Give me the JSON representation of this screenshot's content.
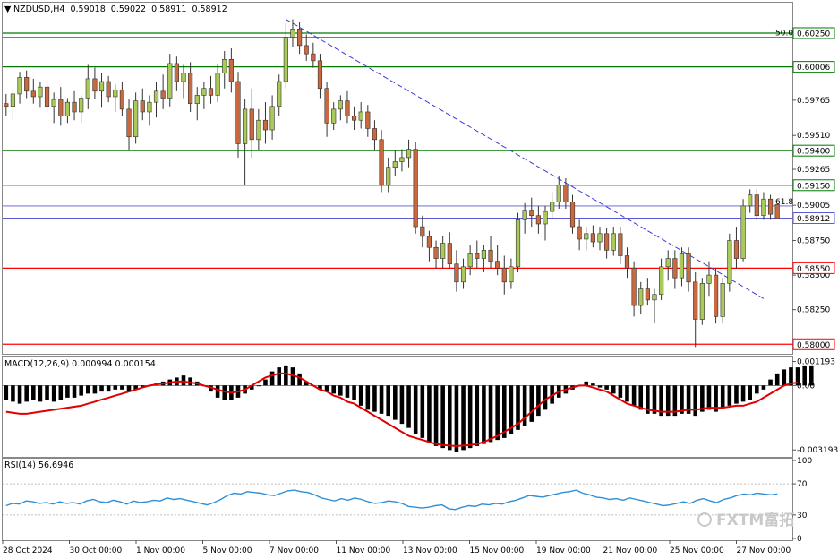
{
  "chart_data": [
    {
      "type": "candlestick",
      "header": {
        "symbol": "NZDUSD,H4",
        "open": "0.59018",
        "high": "0.59022",
        "low": "0.58911",
        "close": "0.58912"
      },
      "ylim": [
        0.5795,
        0.6036
      ],
      "y_ticks": [
        "0.60250",
        "0.60006",
        "0.59765",
        "0.59510",
        "0.59265",
        "0.59005",
        "0.58750",
        "0.58500",
        "0.58250",
        "0.58000"
      ],
      "x_labels": [
        "28 Oct 2024",
        "30 Oct 00:00",
        "1 Nov 00:00",
        "5 Nov 00:00",
        "7 Nov 00:00",
        "11 Nov 00:00",
        "13 Nov 00:00",
        "15 Nov 00:00",
        "19 Nov 00:00",
        "21 Nov 00:00",
        "25 Nov 00:00",
        "27 Nov 00:00"
      ],
      "candles": [
        [
          0.5974,
          0.5981,
          0.5965,
          0.5972
        ],
        [
          0.5972,
          0.5985,
          0.5962,
          0.5981
        ],
        [
          0.5981,
          0.5997,
          0.5974,
          0.5993
        ],
        [
          0.5993,
          0.5998,
          0.5978,
          0.5983
        ],
        [
          0.5983,
          0.5992,
          0.5974,
          0.5979
        ],
        [
          0.5979,
          0.599,
          0.5971,
          0.5986
        ],
        [
          0.5986,
          0.5991,
          0.5968,
          0.5972
        ],
        [
          0.5972,
          0.5982,
          0.596,
          0.5977
        ],
        [
          0.5977,
          0.5986,
          0.5958,
          0.5965
        ],
        [
          0.5965,
          0.5978,
          0.596,
          0.5975
        ],
        [
          0.5975,
          0.5983,
          0.5962,
          0.5968
        ],
        [
          0.5968,
          0.598,
          0.596,
          0.5978
        ],
        [
          0.5978,
          0.6002,
          0.597,
          0.5992
        ],
        [
          0.5992,
          0.6,
          0.5977,
          0.5983
        ],
        [
          0.5983,
          0.5996,
          0.5971,
          0.599
        ],
        [
          0.599,
          0.5994,
          0.5975,
          0.5979
        ],
        [
          0.5979,
          0.5988,
          0.5968,
          0.5984
        ],
        [
          0.5984,
          0.599,
          0.5965,
          0.597
        ],
        [
          0.597,
          0.5977,
          0.594,
          0.595
        ],
        [
          0.595,
          0.5982,
          0.5945,
          0.5976
        ],
        [
          0.5976,
          0.5985,
          0.5962,
          0.5968
        ],
        [
          0.5968,
          0.598,
          0.5958,
          0.5975
        ],
        [
          0.5975,
          0.599,
          0.5964,
          0.5983
        ],
        [
          0.5983,
          0.5995,
          0.597,
          0.5978
        ],
        [
          0.5978,
          0.601,
          0.5972,
          0.6003
        ],
        [
          0.6003,
          0.6008,
          0.5983,
          0.599
        ],
        [
          0.599,
          0.6002,
          0.5978,
          0.5996
        ],
        [
          0.5996,
          0.6004,
          0.5968,
          0.5974
        ],
        [
          0.5974,
          0.5986,
          0.5962,
          0.598
        ],
        [
          0.598,
          0.599,
          0.597,
          0.5985
        ],
        [
          0.5985,
          0.5994,
          0.5974,
          0.598
        ],
        [
          0.598,
          0.6003,
          0.5975,
          0.5996
        ],
        [
          0.5996,
          0.6012,
          0.5985,
          0.6006
        ],
        [
          0.6006,
          0.6014,
          0.5982,
          0.599
        ],
        [
          0.599,
          0.5997,
          0.5935,
          0.5945
        ],
        [
          0.5945,
          0.5977,
          0.5915,
          0.597
        ],
        [
          0.597,
          0.5985,
          0.5935,
          0.5948
        ],
        [
          0.5948,
          0.597,
          0.594,
          0.5962
        ],
        [
          0.5962,
          0.5975,
          0.5945,
          0.5955
        ],
        [
          0.5955,
          0.598,
          0.5948,
          0.5972
        ],
        [
          0.5972,
          0.5995,
          0.5965,
          0.599
        ],
        [
          0.599,
          0.6032,
          0.5985,
          0.6022
        ],
        [
          0.6022,
          0.6035,
          0.6015,
          0.6028
        ],
        [
          0.6028,
          0.6033,
          0.601,
          0.6016
        ],
        [
          0.6016,
          0.6024,
          0.6005,
          0.601
        ],
        [
          0.601,
          0.6018,
          0.6,
          0.6005
        ],
        [
          0.6005,
          0.601,
          0.5978,
          0.5985
        ],
        [
          0.5985,
          0.599,
          0.595,
          0.596
        ],
        [
          0.596,
          0.5975,
          0.5955,
          0.597
        ],
        [
          0.597,
          0.598,
          0.5962,
          0.5976
        ],
        [
          0.5976,
          0.5983,
          0.596,
          0.5965
        ],
        [
          0.5965,
          0.5972,
          0.5955,
          0.5962
        ],
        [
          0.5962,
          0.5975,
          0.5956,
          0.5968
        ],
        [
          0.5968,
          0.5973,
          0.595,
          0.5956
        ],
        [
          0.5956,
          0.5962,
          0.594,
          0.5948
        ],
        [
          0.5948,
          0.5955,
          0.591,
          0.5915
        ],
        [
          0.5915,
          0.5935,
          0.591,
          0.5928
        ],
        [
          0.5928,
          0.594,
          0.5922,
          0.5932
        ],
        [
          0.5932,
          0.5941,
          0.5925,
          0.5935
        ],
        [
          0.5935,
          0.5948,
          0.5928,
          0.5941
        ],
        [
          0.5941,
          0.5946,
          0.588,
          0.5885
        ],
        [
          0.5885,
          0.5893,
          0.587,
          0.5878
        ],
        [
          0.5878,
          0.5882,
          0.586,
          0.587
        ],
        [
          0.587,
          0.5875,
          0.5855,
          0.5862
        ],
        [
          0.5862,
          0.5878,
          0.5855,
          0.5873
        ],
        [
          0.5873,
          0.5881,
          0.5855,
          0.5858
        ],
        [
          0.5858,
          0.5868,
          0.5838,
          0.5845
        ],
        [
          0.5845,
          0.5862,
          0.584,
          0.5856
        ],
        [
          0.5856,
          0.5872,
          0.585,
          0.5866
        ],
        [
          0.5866,
          0.5875,
          0.5855,
          0.5862
        ],
        [
          0.5862,
          0.5872,
          0.5852,
          0.5868
        ],
        [
          0.5868,
          0.5878,
          0.5855,
          0.586
        ],
        [
          0.586,
          0.5872,
          0.585,
          0.5855
        ],
        [
          0.5855,
          0.5864,
          0.5836,
          0.5845
        ],
        [
          0.5845,
          0.5862,
          0.584,
          0.5856
        ],
        [
          0.5856,
          0.5895,
          0.5852,
          0.589
        ],
        [
          0.589,
          0.5902,
          0.588,
          0.5897
        ],
        [
          0.5897,
          0.5906,
          0.5885,
          0.5893
        ],
        [
          0.5893,
          0.59,
          0.588,
          0.5887
        ],
        [
          0.5887,
          0.59,
          0.5875,
          0.5896
        ],
        [
          0.5896,
          0.591,
          0.589,
          0.5903
        ],
        [
          0.5903,
          0.5922,
          0.5898,
          0.5915
        ],
        [
          0.5915,
          0.592,
          0.5898,
          0.5903
        ],
        [
          0.5903,
          0.5908,
          0.588,
          0.5885
        ],
        [
          0.5885,
          0.589,
          0.5868,
          0.5876
        ],
        [
          0.5876,
          0.5885,
          0.5868,
          0.588
        ],
        [
          0.588,
          0.5886,
          0.587,
          0.5874
        ],
        [
          0.5874,
          0.5885,
          0.5868,
          0.588
        ],
        [
          0.588,
          0.5884,
          0.5862,
          0.5868
        ],
        [
          0.5868,
          0.5885,
          0.5864,
          0.588
        ],
        [
          0.588,
          0.5885,
          0.5858,
          0.5864
        ],
        [
          0.5864,
          0.587,
          0.5848,
          0.5855
        ],
        [
          0.5855,
          0.586,
          0.582,
          0.5828
        ],
        [
          0.5828,
          0.5845,
          0.5822,
          0.584
        ],
        [
          0.584,
          0.5848,
          0.5828,
          0.5832
        ],
        [
          0.5832,
          0.584,
          0.5815,
          0.5836
        ],
        [
          0.5836,
          0.5862,
          0.5832,
          0.5856
        ],
        [
          0.5856,
          0.5868,
          0.5846,
          0.5862
        ],
        [
          0.5862,
          0.5868,
          0.584,
          0.5848
        ],
        [
          0.5848,
          0.587,
          0.5842,
          0.5866
        ],
        [
          0.5866,
          0.587,
          0.5838,
          0.5845
        ],
        [
          0.5845,
          0.5852,
          0.5798,
          0.5818
        ],
        [
          0.5818,
          0.5848,
          0.5814,
          0.5844
        ],
        [
          0.5844,
          0.586,
          0.5835,
          0.585
        ],
        [
          0.585,
          0.5855,
          0.5815,
          0.582
        ],
        [
          0.582,
          0.5848,
          0.5815,
          0.5844
        ],
        [
          0.5844,
          0.588,
          0.5838,
          0.5875
        ],
        [
          0.5875,
          0.5885,
          0.5855,
          0.5862
        ],
        [
          0.5862,
          0.5905,
          0.586,
          0.59
        ],
        [
          0.59,
          0.5912,
          0.5895,
          0.5908
        ],
        [
          0.5908,
          0.5912,
          0.589,
          0.5893
        ],
        [
          0.5893,
          0.591,
          0.589,
          0.5905
        ],
        [
          0.5905,
          0.5908,
          0.589,
          0.5894
        ],
        [
          0.5901,
          0.5902,
          0.5891,
          0.5891
        ]
      ],
      "horizontal_levels": [
        {
          "value": 0.6025,
          "label": "0.60250",
          "color": "#007a00"
        },
        {
          "value": 0.60006,
          "label": "0.60006",
          "color": "#007a00"
        },
        {
          "value": 0.594,
          "label": "0.59400",
          "color": "#007a00"
        },
        {
          "value": 0.5915,
          "label": "0.59150",
          "color": "#007a00"
        },
        {
          "value": 0.5855,
          "label": "0.58550",
          "color": "#ff0000"
        },
        {
          "value": 0.58,
          "label": "0.58000",
          "color": "#ff0000"
        }
      ],
      "fib_levels": [
        {
          "value": 0.6022,
          "label": "50.0"
        },
        {
          "value": 0.59,
          "label": "61.8"
        },
        {
          "value": 0.58912,
          "label": "0.58912"
        }
      ],
      "trendline": {
        "from": [
          41,
          0.6035
        ],
        "to": [
          111,
          0.5833
        ],
        "color": "#3b3bd6"
      },
      "current_price": "0.58912"
    },
    {
      "type": "macd",
      "header": "MACD(12,26,9) 0.000994 0.000154",
      "ylim": [
        -0.00345,
        0.00135
      ],
      "y_ticks": [
        "0.001193",
        "0.00",
        "-0.003193"
      ],
      "histogram": [
        -0.0007,
        -0.0008,
        -0.0009,
        -0.0008,
        -0.0007,
        -0.0008,
        -0.0007,
        -0.0008,
        -0.0007,
        -0.0006,
        -0.0006,
        -0.0005,
        -0.0004,
        -0.0004,
        -0.0003,
        -0.0003,
        -0.0002,
        -0.0002,
        -0.0003,
        -0.0002,
        -0.0001,
        0.0,
        0.0001,
        0.0002,
        0.0003,
        0.0004,
        0.0005,
        0.0004,
        0.0002,
        0.0,
        -0.0003,
        -0.0006,
        -0.0007,
        -0.0007,
        -0.0006,
        -0.0004,
        -0.0002,
        0.0,
        0.0003,
        0.0007,
        0.0009,
        0.001,
        0.0009,
        0.0006,
        0.0002,
        0.0,
        -0.0002,
        -0.0003,
        -0.0004,
        -0.0005,
        -0.0006,
        -0.0007,
        -0.001,
        -0.0012,
        -0.0013,
        -0.0014,
        -0.0015,
        -0.0017,
        -0.0019,
        -0.0021,
        -0.0024,
        -0.0026,
        -0.0028,
        -0.003,
        -0.0031,
        -0.0032,
        -0.0033,
        -0.0032,
        -0.0031,
        -0.003,
        -0.0029,
        -0.0028,
        -0.0027,
        -0.0026,
        -0.0024,
        -0.0022,
        -0.002,
        -0.0018,
        -0.0015,
        -0.0012,
        -0.0009,
        -0.0006,
        -0.0004,
        -0.0002,
        0.0,
        0.0002,
        0.0001,
        -0.0001,
        -0.0002,
        -0.0004,
        -0.0006,
        -0.0008,
        -0.001,
        -0.0012,
        -0.0014,
        -0.0014,
        -0.0015,
        -0.0015,
        -0.0015,
        -0.0014,
        -0.0014,
        -0.0015,
        -0.0013,
        -0.0012,
        -0.0013,
        -0.0011,
        -0.001,
        -0.0009,
        -0.0008,
        -0.0007,
        -0.0004,
        -0.0002,
        0.0003,
        0.0006,
        0.0008,
        0.0009,
        0.0009,
        0.001,
        0.001
      ],
      "signal": [
        -0.0013,
        -0.00135,
        -0.0014,
        -0.0014,
        -0.00135,
        -0.0013,
        -0.00125,
        -0.0012,
        -0.00115,
        -0.0011,
        -0.00105,
        -0.001,
        -0.0009,
        -0.0008,
        -0.0007,
        -0.0006,
        -0.0005,
        -0.0004,
        -0.0003,
        -0.0002,
        -0.0001,
        0.0,
        5e-05,
        0.0001,
        0.00015,
        0.0002,
        0.0002,
        0.00015,
        0.0001,
        0.0,
        -0.0001,
        -0.0002,
        -0.0003,
        -0.00035,
        -0.0003,
        -0.0002,
        0.0,
        0.0002,
        0.0004,
        0.0005,
        0.0006,
        0.0006,
        0.0005,
        0.0004,
        0.0002,
        0.0,
        -0.0002,
        -0.0003,
        -0.0005,
        -0.0006,
        -0.0008,
        -0.0009,
        -0.0011,
        -0.0013,
        -0.0015,
        -0.0017,
        -0.0019,
        -0.0021,
        -0.0023,
        -0.0025,
        -0.0026,
        -0.0027,
        -0.0028,
        -0.0029,
        -0.00295,
        -0.00298,
        -0.003,
        -0.00298,
        -0.00295,
        -0.0029,
        -0.0028,
        -0.00265,
        -0.0025,
        -0.0023,
        -0.0021,
        -0.0019,
        -0.0016,
        -0.0013,
        -0.001,
        -0.0007,
        -0.0005,
        -0.0003,
        -0.0002,
        -0.0001,
        0.0,
        0.0,
        -0.0001,
        -0.0002,
        -0.0003,
        -0.0005,
        -0.0007,
        -0.0009,
        -0.001,
        -0.0011,
        -0.0012,
        -0.00125,
        -0.0013,
        -0.0013,
        -0.0013,
        -0.00125,
        -0.0012,
        -0.0012,
        -0.00115,
        -0.0011,
        -0.0011,
        -0.0011,
        -0.00105,
        -0.001,
        -0.001,
        -0.0009,
        -0.0008,
        -0.0006,
        -0.0004,
        -0.0002,
        0.0,
        0.0001,
        0.00015
      ],
      "colors": {
        "histogram": "#000000",
        "signal": "#e00000"
      }
    },
    {
      "type": "line",
      "header": "RSI(14) 56.6946",
      "ylim": [
        0,
        100
      ],
      "y_ticks": [
        "100",
        "70",
        "30",
        "0"
      ],
      "values": [
        42,
        45,
        44,
        48,
        47,
        45,
        46,
        44,
        47,
        45,
        46,
        44,
        48,
        50,
        47,
        46,
        49,
        47,
        44,
        48,
        46,
        47,
        49,
        48,
        52,
        50,
        51,
        49,
        47,
        45,
        43,
        46,
        50,
        55,
        58,
        57,
        60,
        59,
        58,
        56,
        55,
        58,
        61,
        62,
        60,
        59,
        56,
        52,
        50,
        48,
        51,
        49,
        52,
        50,
        47,
        45,
        46,
        48,
        47,
        45,
        41,
        40,
        39,
        40,
        42,
        43,
        38,
        37,
        40,
        42,
        41,
        44,
        43,
        45,
        44,
        47,
        49,
        52,
        55,
        54,
        53,
        55,
        57,
        59,
        60,
        62,
        58,
        56,
        53,
        52,
        50,
        51,
        49,
        52,
        50,
        48,
        46,
        44,
        42,
        43,
        45,
        47,
        45,
        49,
        51,
        48,
        46,
        50,
        52,
        55,
        57,
        56,
        58,
        57,
        56,
        57
      ],
      "color": "#2f8fd6"
    }
  ],
  "watermark": "FXTM富拓"
}
